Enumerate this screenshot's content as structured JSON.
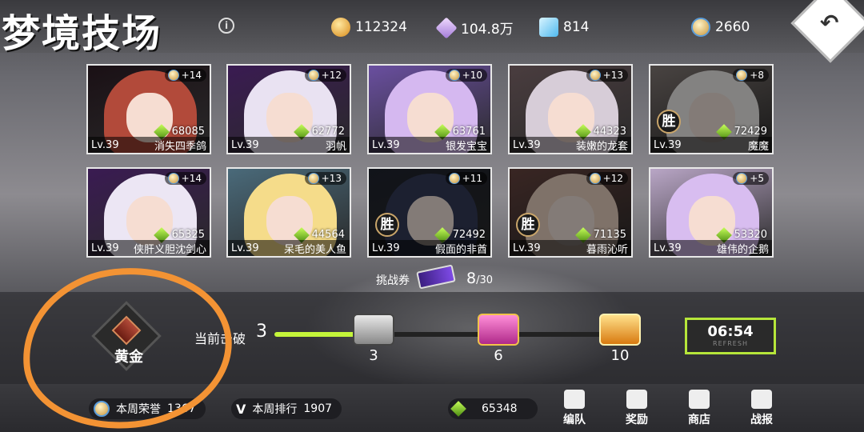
{
  "header": {
    "title": "梦境技场",
    "info_icon": "i",
    "back_icon": "↶"
  },
  "resources": [
    {
      "icon": "gold-coin-icon",
      "value": "112324"
    },
    {
      "icon": "crystal-icon",
      "value": "104.8万"
    },
    {
      "icon": "diamond-icon",
      "value": "814"
    },
    {
      "icon": "honor-medal-icon",
      "value": "2660"
    }
  ],
  "opponents": [
    {
      "plus": "+14",
      "power": "68085",
      "level": "Lv.39",
      "name": "消失四季鸽",
      "won": false
    },
    {
      "plus": "+12",
      "power": "62772",
      "level": "Lv.39",
      "name": "羽帆",
      "won": false
    },
    {
      "plus": "+10",
      "power": "63761",
      "level": "Lv.39",
      "name": "银发宝宝",
      "won": false
    },
    {
      "plus": "+13",
      "power": "44323",
      "level": "Lv.39",
      "name": "装嫩的龙套",
      "won": false
    },
    {
      "plus": "+8",
      "power": "72429",
      "level": "Lv.39",
      "name": "魔魔",
      "won": true,
      "win_text": "胜"
    },
    {
      "plus": "+14",
      "power": "65325",
      "level": "Lv.39",
      "name": "侠肝义胆沈剑心",
      "won": false
    },
    {
      "plus": "+13",
      "power": "44564",
      "level": "Lv.39",
      "name": "呆毛的美人鱼",
      "won": false
    },
    {
      "plus": "+11",
      "power": "72492",
      "level": "Lv.39",
      "name": "假面的非酋",
      "won": true,
      "win_text": "胜"
    },
    {
      "plus": "+12",
      "power": "71135",
      "level": "Lv.39",
      "name": "暮雨沁听",
      "won": true,
      "win_text": "胜"
    },
    {
      "plus": "+5",
      "power": "53320",
      "level": "Lv.39",
      "name": "雄伟的企鹅",
      "won": false
    }
  ],
  "ticket": {
    "label": "挑战券",
    "count": "8",
    "max": "/30"
  },
  "rank": {
    "tier": "黄金"
  },
  "progress": {
    "label": "当前击破",
    "current": "3",
    "fraction": 0.25,
    "milestones": [
      {
        "value": "3",
        "icon": "silver-chest-icon"
      },
      {
        "value": "6",
        "icon": "pink-chest-icon"
      },
      {
        "value": "10",
        "icon": "gold-chest-icon"
      }
    ]
  },
  "refresh": {
    "time": "06:54",
    "sub": "REFRESH"
  },
  "footer": {
    "weekly_honor_label": "本周荣誉",
    "weekly_honor_value": "1367",
    "weekly_rank_label": "本周排行",
    "weekly_rank_value": "1907",
    "power_value": "65348",
    "nav": [
      {
        "label": "编队",
        "icon": "team-icon"
      },
      {
        "label": "奖励",
        "icon": "gift-icon"
      },
      {
        "label": "商店",
        "icon": "cart-icon"
      },
      {
        "label": "战报",
        "icon": "report-icon"
      }
    ]
  },
  "colors": {
    "accent_green": "#c4f53a",
    "annotation_orange": "#f39334"
  }
}
